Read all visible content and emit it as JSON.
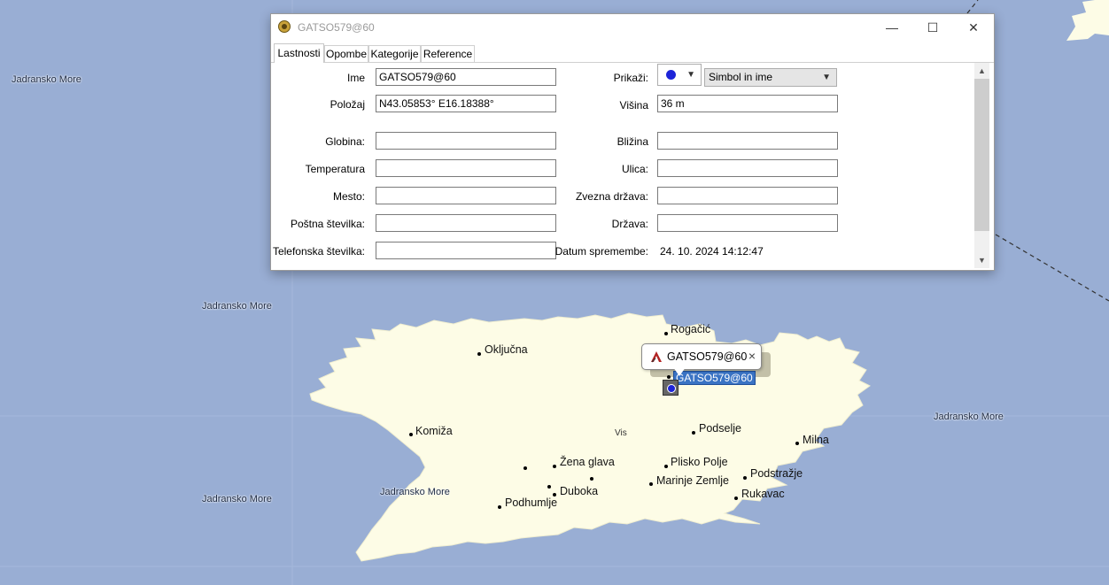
{
  "window": {
    "title": "GATSO579@60",
    "minimize": "—",
    "maximize": "☐",
    "close": "✕"
  },
  "tabs": [
    "Lastnosti",
    "Opombe",
    "Kategorije",
    "Reference"
  ],
  "form": {
    "ime_label": "Ime",
    "ime_value": "GATSO579@60",
    "polozaj_label": "Položaj",
    "polozaj_value": "N43.05853° E16.18388°",
    "globina_label": "Globina:",
    "temperatura_label": "Temperatura",
    "mesto_label": "Mesto:",
    "postna_label": "Poštna številka:",
    "telefonska_label": "Telefonska številka:",
    "prikazi_label": "Prikaži:",
    "prikazi_value": "Simbol in ime",
    "visina_label": "Višina",
    "visina_value": "36 m",
    "blizina_label": "Bližina",
    "ulica_label": "Ulica:",
    "zvezna_label": "Zvezna država:",
    "drzava_label": "Država:",
    "datum_label": "Datum spremembe:",
    "datum_value": "24. 10. 2024 14:12:47"
  },
  "map": {
    "sea_labels": [
      "Jadransko More",
      "Jadransko More",
      "Jadransko More",
      "Jadransko More",
      "Jadransko More"
    ],
    "island_label": "Vis",
    "places": [
      "Rogačić",
      "Oključna",
      "Komiža",
      "Podselje",
      "Milna",
      "Žena glava",
      "Plisko Polje",
      "Podstražje",
      "Duboka",
      "Marinje Zemlje",
      "Rukavac",
      "Podhumlje"
    ],
    "popup_title": "GATSO579@60",
    "popup_close": "×",
    "waypoint_label": "GATSO579@60"
  },
  "colors": {
    "sea": "#99aed4",
    "land": "#fdfce6",
    "marker": "#1d24d8",
    "selection": "#3a73c4"
  }
}
